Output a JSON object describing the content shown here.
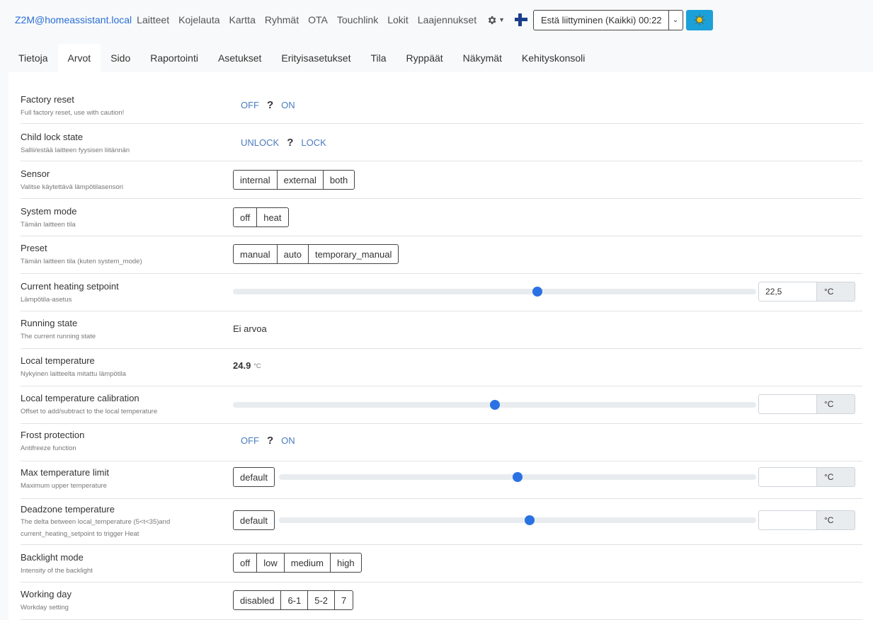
{
  "nav": {
    "brand": "Z2M@homeassistant.local",
    "links": [
      "Laitteet",
      "Kojelauta",
      "Kartta",
      "Ryhmät",
      "OTA",
      "Touchlink",
      "Lokit",
      "Laajennukset"
    ],
    "join_button": "Estä liittyminen (Kaikki) 00:22",
    "icons": {
      "settings": "gear-icon",
      "language": "finland-flag-icon",
      "theme": "sun-icon"
    },
    "accent_color": "#2a6fd6",
    "theme_button_color": "#1ba0d9"
  },
  "tabs": [
    "Tietoja",
    "Arvot",
    "Sido",
    "Raportointi",
    "Asetukset",
    "Erityisasetukset",
    "Tila",
    "Ryppäät",
    "Näkymät",
    "Kehityskonsoli"
  ],
  "active_tab": "Arvot",
  "features": {
    "factory_reset": {
      "label": "Factory reset",
      "desc": "Full factory reset, use with caution!",
      "off": "OFF",
      "q": "?",
      "on": "ON"
    },
    "child_lock": {
      "label": "Child lock state",
      "desc": "Sallii/estää laitteen fyysisen liitännän",
      "off": "UNLOCK",
      "q": "?",
      "on": "LOCK"
    },
    "sensor": {
      "label": "Sensor",
      "desc": "Valitse käytettävä lämpötilasensori",
      "options": [
        "internal",
        "external",
        "both"
      ]
    },
    "system_mode": {
      "label": "System mode",
      "desc": "Tämän laitteen tila",
      "options": [
        "off",
        "heat"
      ]
    },
    "preset": {
      "label": "Preset",
      "desc": "Tämän laitteen tila (kuten system_mode)",
      "options": [
        "manual",
        "auto",
        "temporary_manual"
      ]
    },
    "heating_setpoint": {
      "label": "Current heating setpoint",
      "desc": "Lämpötila-asetus",
      "value": "22,5",
      "unit": "°C",
      "slider_fraction": 0.582
    },
    "running_state": {
      "label": "Running state",
      "desc": "The current running state",
      "value": "Ei arvoa"
    },
    "local_temperature": {
      "label": "Local temperature",
      "desc": "Nykyinen laitteelta mitattu lämpötila",
      "value": "24.9",
      "unit": "°C"
    },
    "temp_calibration": {
      "label": "Local temperature calibration",
      "desc": "Offset to add/subtract to the local temperature",
      "value": "",
      "unit": "°C",
      "slider_fraction": 0.5
    },
    "frost_protection": {
      "label": "Frost protection",
      "desc": "Antifreeze function",
      "off": "OFF",
      "q": "?",
      "on": "ON"
    },
    "max_temp_limit": {
      "label": "Max temperature limit",
      "desc": "Maximum upper temperature",
      "default_label": "default",
      "value": "",
      "unit": "°C",
      "slider_fraction": 0.5
    },
    "deadzone_temp": {
      "label": "Deadzone temperature",
      "desc": "The delta between local_temperature (5<t<35)and current_heating_setpoint to trigger Heat",
      "default_label": "default",
      "value": "",
      "unit": "°C",
      "slider_fraction": 0.525
    },
    "backlight_mode": {
      "label": "Backlight mode",
      "desc": "Intensity of the backlight",
      "options": [
        "off",
        "low",
        "medium",
        "high"
      ]
    },
    "working_day": {
      "label": "Working day",
      "desc": "Workday setting",
      "options": [
        "disabled",
        "6-1",
        "5-2",
        "7"
      ]
    }
  }
}
